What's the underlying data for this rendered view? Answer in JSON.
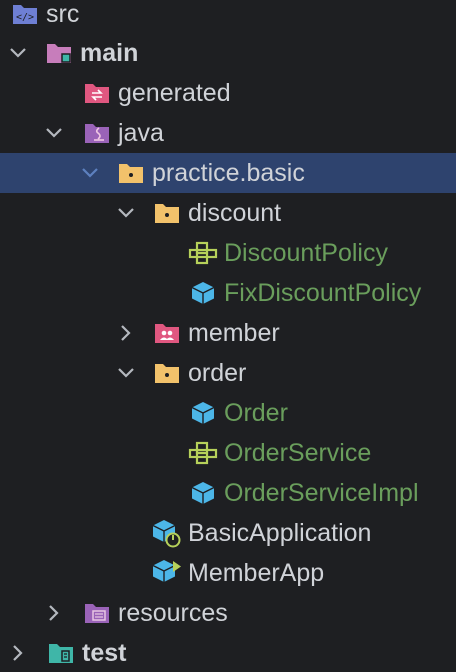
{
  "project_tree": {
    "src": "src",
    "main": "main",
    "generated": "generated",
    "java": "java",
    "practice_basic": "practice.basic",
    "discount": "discount",
    "discount_policy": "DiscountPolicy",
    "fix_discount_policy": "FixDiscountPolicy",
    "member": "member",
    "order": "order",
    "order_class": "Order",
    "order_service": "OrderService",
    "order_service_impl": "OrderServiceImpl",
    "basic_application": "BasicApplication",
    "member_app": "MemberApp",
    "resources": "resources",
    "test": "test"
  },
  "colors": {
    "background": "#1e1f22",
    "selection": "#2e436e",
    "text": "#d0d3d8",
    "modified_text": "#6a9e5c"
  }
}
